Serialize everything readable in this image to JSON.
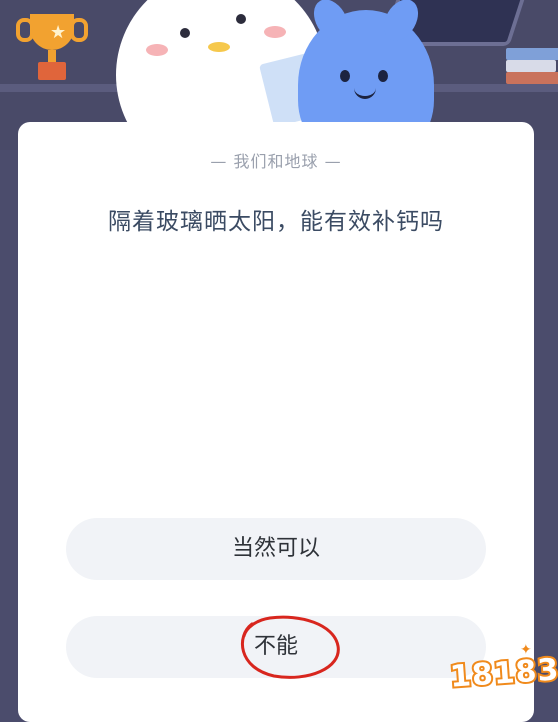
{
  "quiz": {
    "category": "— 我们和地球 —",
    "question": "隔着玻璃晒太阳，能有效补钙吗",
    "options": [
      {
        "label": "当然可以"
      },
      {
        "label": "不能"
      }
    ]
  },
  "watermark": {
    "text": "18183"
  },
  "icons": {
    "trophy": "trophy-icon",
    "books": "books-icon",
    "penguin": "penguin-mascot-illustration",
    "blue_creature": "blue-creature-mascot-illustration",
    "circle": "hand-drawn-circle-mark"
  },
  "colors": {
    "header_bg": "#494a68",
    "card_bg": "#ffffff",
    "option_bg": "#f1f3f7",
    "question_text": "#3b4b63",
    "circle_red": "#d8261e"
  }
}
